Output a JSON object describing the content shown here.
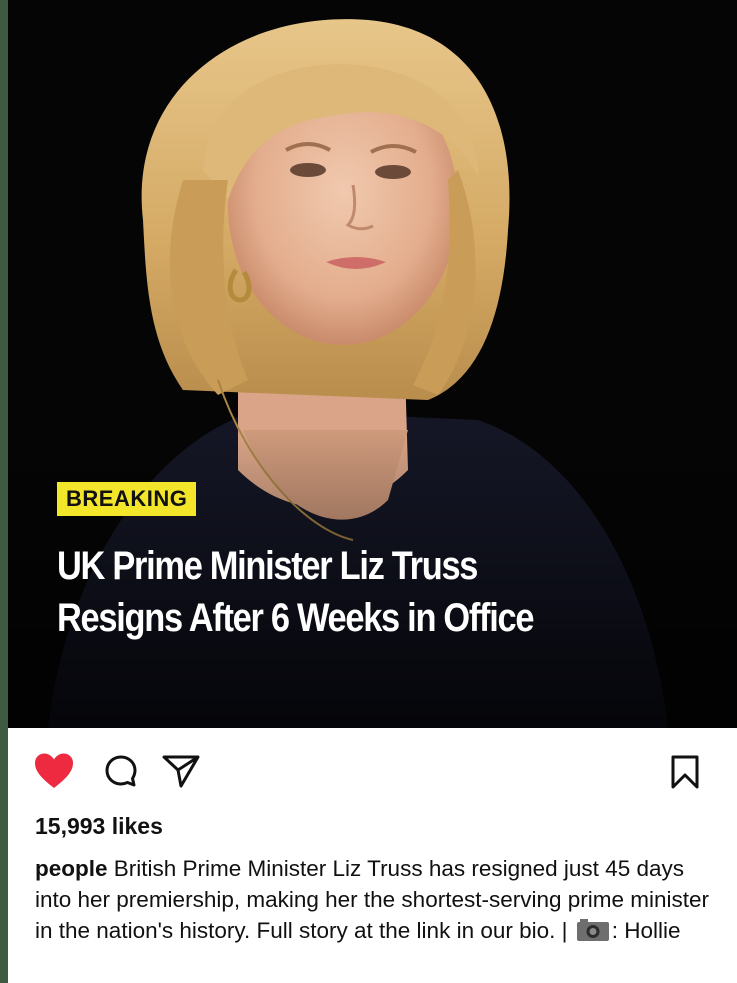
{
  "post": {
    "badge": "BREAKING",
    "headline_line1": "UK Prime Minister Liz Truss",
    "headline_line2": "Resigns After 6 Weeks in Office",
    "badge_color": "#f3e62a"
  },
  "actions": {
    "like_icon": "heart-filled-icon",
    "comment_icon": "comment-icon",
    "share_icon": "send-icon",
    "save_icon": "bookmark-icon",
    "like_color": "#ed2a3f"
  },
  "likes": {
    "text": "15,993 likes"
  },
  "caption": {
    "username": "people",
    "text": " British Prime Minister Liz Truss has resigned just 45 days into her premiership, making her the shortest-serving prime minister in the nation's history. Full story at the link in our bio. | ",
    "camera_icon": "camera-icon",
    "credit": ": Hollie"
  }
}
